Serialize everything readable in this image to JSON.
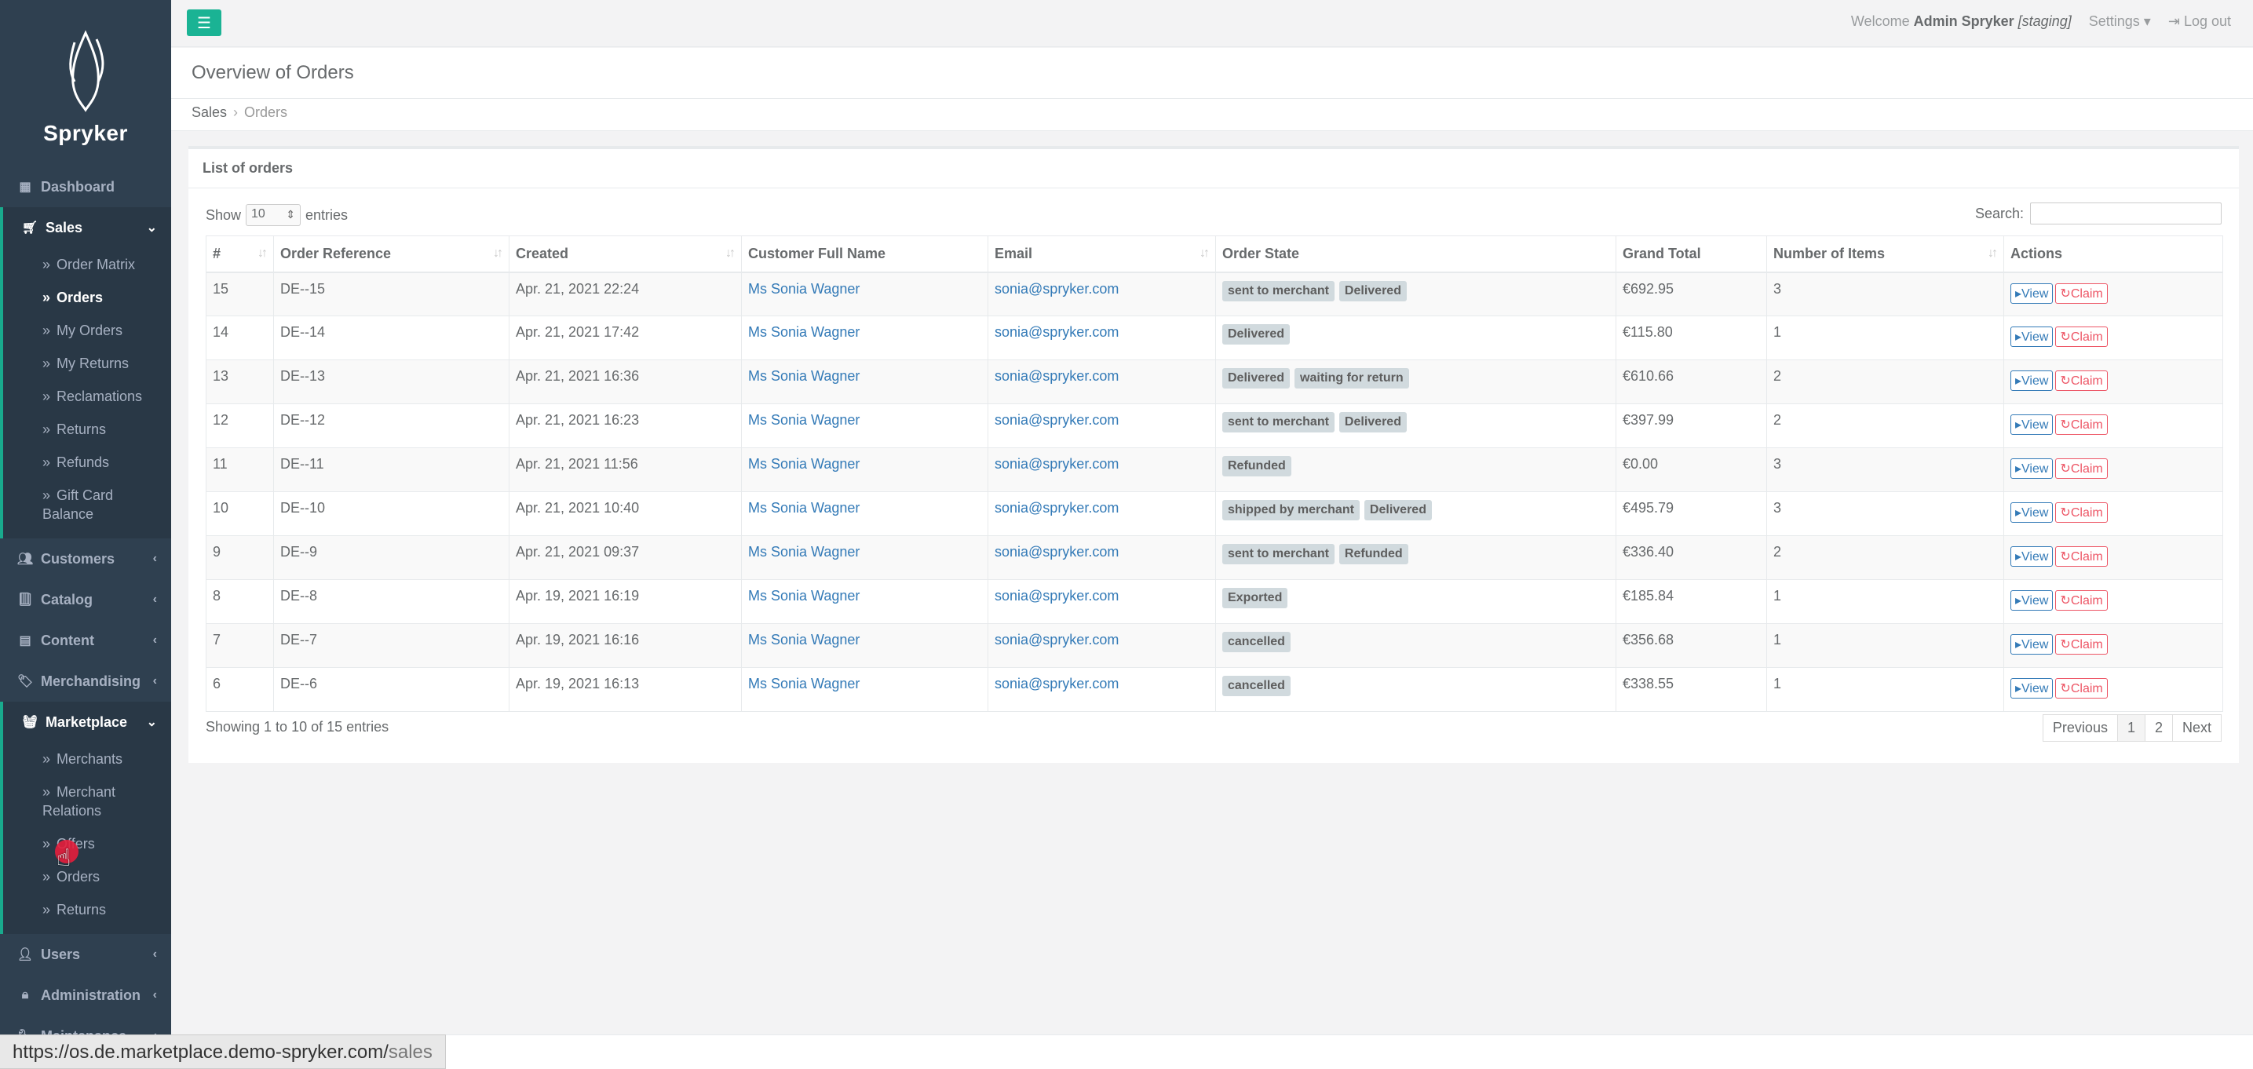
{
  "sidebar": {
    "logo_text": "Spryker",
    "items": [
      {
        "label": "Dashboard"
      },
      {
        "label": "Sales",
        "sub": [
          "Order Matrix",
          "Orders",
          "My Orders",
          "My Returns",
          "Reclamations",
          "Returns",
          "Refunds",
          "Gift Card Balance"
        ]
      },
      {
        "label": "Customers"
      },
      {
        "label": "Catalog"
      },
      {
        "label": "Content"
      },
      {
        "label": "Merchandising"
      },
      {
        "label": "Marketplace",
        "sub": [
          "Merchants",
          "Merchant Relations",
          "Offers",
          "Orders",
          "Returns"
        ]
      },
      {
        "label": "Users"
      },
      {
        "label": "Administration"
      },
      {
        "label": "Maintenance"
      }
    ]
  },
  "topbar": {
    "welcome_prefix": "Welcome",
    "user": "Admin Spryker",
    "env": "[staging]",
    "settings": "Settings",
    "logout": "Log out"
  },
  "heading": {
    "title": "Overview of Orders",
    "breadcrumb": [
      "Sales",
      "Orders"
    ]
  },
  "box": {
    "title": "List of orders",
    "show_label": "Show",
    "entries_value": "10",
    "entries_label": "entries",
    "search_label": "Search:",
    "columns": [
      "#",
      "Order Reference",
      "Created",
      "Customer Full Name",
      "Email",
      "Order State",
      "Grand Total",
      "Number of Items",
      "Actions"
    ],
    "rows": [
      {
        "id": "15",
        "ref": "DE--15",
        "created": "Apr. 21, 2021 22:24",
        "customer": "Ms Sonia Wagner",
        "email": "sonia@spryker.com",
        "states": [
          "sent to merchant",
          "Delivered"
        ],
        "total": "€692.95",
        "items": "3"
      },
      {
        "id": "14",
        "ref": "DE--14",
        "created": "Apr. 21, 2021 17:42",
        "customer": "Ms Sonia Wagner",
        "email": "sonia@spryker.com",
        "states": [
          "Delivered"
        ],
        "total": "€115.80",
        "items": "1"
      },
      {
        "id": "13",
        "ref": "DE--13",
        "created": "Apr. 21, 2021 16:36",
        "customer": "Ms Sonia Wagner",
        "email": "sonia@spryker.com",
        "states": [
          "Delivered",
          "waiting for return"
        ],
        "total": "€610.66",
        "items": "2"
      },
      {
        "id": "12",
        "ref": "DE--12",
        "created": "Apr. 21, 2021 16:23",
        "customer": "Ms Sonia Wagner",
        "email": "sonia@spryker.com",
        "states": [
          "sent to merchant",
          "Delivered"
        ],
        "total": "€397.99",
        "items": "2"
      },
      {
        "id": "11",
        "ref": "DE--11",
        "created": "Apr. 21, 2021 11:56",
        "customer": "Ms Sonia Wagner",
        "email": "sonia@spryker.com",
        "states": [
          "Refunded"
        ],
        "total": "€0.00",
        "items": "3"
      },
      {
        "id": "10",
        "ref": "DE--10",
        "created": "Apr. 21, 2021 10:40",
        "customer": "Ms Sonia Wagner",
        "email": "sonia@spryker.com",
        "states": [
          "shipped by merchant",
          "Delivered"
        ],
        "total": "€495.79",
        "items": "3"
      },
      {
        "id": "9",
        "ref": "DE--9",
        "created": "Apr. 21, 2021 09:37",
        "customer": "Ms Sonia Wagner",
        "email": "sonia@spryker.com",
        "states": [
          "sent to merchant",
          "Refunded"
        ],
        "total": "€336.40",
        "items": "2"
      },
      {
        "id": "8",
        "ref": "DE--8",
        "created": "Apr. 19, 2021 16:19",
        "customer": "Ms Sonia Wagner",
        "email": "sonia@spryker.com",
        "states": [
          "Exported"
        ],
        "total": "€185.84",
        "items": "1"
      },
      {
        "id": "7",
        "ref": "DE--7",
        "created": "Apr. 19, 2021 16:16",
        "customer": "Ms Sonia Wagner",
        "email": "sonia@spryker.com",
        "states": [
          "cancelled"
        ],
        "total": "€356.68",
        "items": "1"
      },
      {
        "id": "6",
        "ref": "DE--6",
        "created": "Apr. 19, 2021 16:13",
        "customer": "Ms Sonia Wagner",
        "email": "sonia@spryker.com",
        "states": [
          "cancelled"
        ],
        "total": "€338.55",
        "items": "1"
      }
    ],
    "view_label": "View",
    "claim_label": "Claim",
    "info": "Showing 1 to 10 of 15 entries",
    "pagination": [
      "Previous",
      "1",
      "2",
      "Next"
    ]
  },
  "statusbar": {
    "url_main": "https://os.de.marketplace.demo-spryker.com/",
    "url_tail": "sales"
  },
  "colors": {
    "sidebar": "#2f4050",
    "accent": "#1ab394",
    "link": "#337ab7",
    "claim": "#ed5565"
  }
}
